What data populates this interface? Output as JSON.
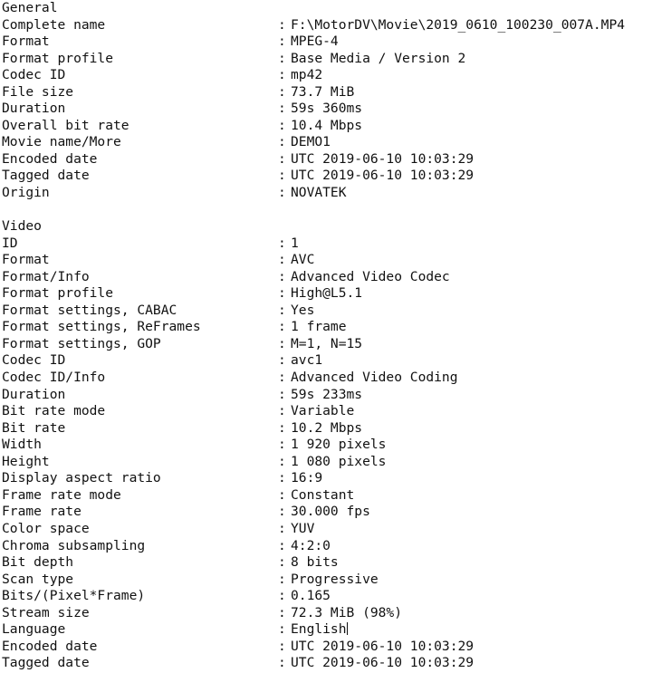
{
  "document": {
    "kind": "mediainfo-text-report",
    "background_color": "#ffffff",
    "text_color": "#111111",
    "separator": ":"
  },
  "sections": [
    {
      "heading": "General",
      "rows": [
        {
          "label": "Complete name",
          "value": "F:\\MotorDV\\Movie\\2019_0610_100230_007A.MP4"
        },
        {
          "label": "Format",
          "value": "MPEG-4"
        },
        {
          "label": "Format profile",
          "value": "Base Media / Version 2"
        },
        {
          "label": "Codec ID",
          "value": "mp42"
        },
        {
          "label": "File size",
          "value": "73.7 MiB"
        },
        {
          "label": "Duration",
          "value": "59s 360ms"
        },
        {
          "label": "Overall bit rate",
          "value": "10.4 Mbps"
        },
        {
          "label": "Movie name/More",
          "value": "DEMO1"
        },
        {
          "label": "Encoded date",
          "value": "UTC 2019-06-10 10:03:29"
        },
        {
          "label": "Tagged date",
          "value": "UTC 2019-06-10 10:03:29"
        },
        {
          "label": "Origin",
          "value": "NOVATEK"
        }
      ]
    },
    {
      "heading": "Video",
      "rows": [
        {
          "label": "ID",
          "value": "1"
        },
        {
          "label": "Format",
          "value": "AVC"
        },
        {
          "label": "Format/Info",
          "value": "Advanced Video Codec"
        },
        {
          "label": "Format profile",
          "value": "High@L5.1"
        },
        {
          "label": "Format settings, CABAC",
          "value": "Yes"
        },
        {
          "label": "Format settings, ReFrames",
          "value": "1 frame"
        },
        {
          "label": "Format settings, GOP",
          "value": "M=1, N=15"
        },
        {
          "label": "Codec ID",
          "value": "avc1"
        },
        {
          "label": "Codec ID/Info",
          "value": "Advanced Video Coding"
        },
        {
          "label": "Duration",
          "value": "59s 233ms"
        },
        {
          "label": "Bit rate mode",
          "value": "Variable"
        },
        {
          "label": "Bit rate",
          "value": "10.2 Mbps"
        },
        {
          "label": "Width",
          "value": "1 920 pixels"
        },
        {
          "label": "Height",
          "value": "1 080 pixels"
        },
        {
          "label": "Display aspect ratio",
          "value": "16:9"
        },
        {
          "label": "Frame rate mode",
          "value": "Constant"
        },
        {
          "label": "Frame rate",
          "value": "30.000 fps"
        },
        {
          "label": "Color space",
          "value": "YUV"
        },
        {
          "label": "Chroma subsampling",
          "value": "4:2:0"
        },
        {
          "label": "Bit depth",
          "value": "8 bits"
        },
        {
          "label": "Scan type",
          "value": "Progressive"
        },
        {
          "label": "Bits/(Pixel*Frame)",
          "value": "0.165"
        },
        {
          "label": "Stream size",
          "value": "72.3 MiB (98%)"
        },
        {
          "label": "Language",
          "value": "English",
          "caret_after": true
        },
        {
          "label": "Encoded date",
          "value": "UTC 2019-06-10 10:03:29"
        },
        {
          "label": "Tagged date",
          "value": "UTC 2019-06-10 10:03:29"
        }
      ]
    }
  ]
}
